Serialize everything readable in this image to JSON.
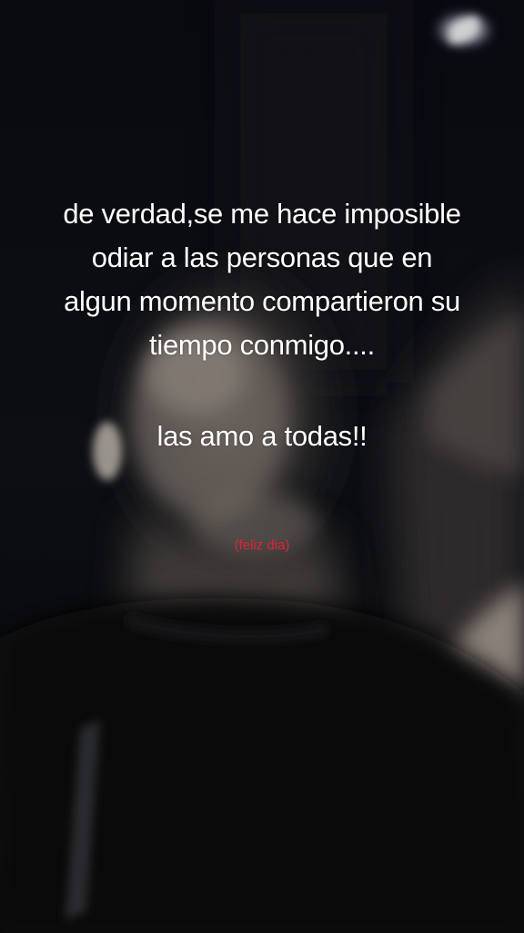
{
  "caption": {
    "lines": [
      "de verdad,se me hace imposible",
      "odiar a las personas que en",
      "algun momento compartieron su",
      "tiempo conmigo...."
    ],
    "love_line": "las amo a todas!!",
    "small_note": "(feliz dia)"
  },
  "colors": {
    "caption_text": "#ffffff",
    "small_note_text": "#e0223a",
    "background": "#07080c"
  }
}
